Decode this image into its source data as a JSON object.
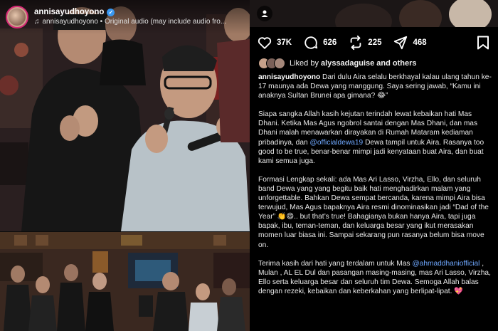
{
  "post": {
    "username": "annisayudhoyono",
    "audio": "annisayudhoyono • Original audio (may include audio fro..."
  },
  "actions": {
    "likes": "37K",
    "comments": "626",
    "reposts": "225",
    "shares": "468"
  },
  "liked_by": {
    "prefix": "Liked by ",
    "user": "alyssadaguise",
    "suffix": " and others"
  },
  "caption": {
    "p1_user": "annisayudhoyono",
    "p1_text": " Dari dulu Aira selalu berkhayal kalau ulang tahun ke-17 maunya ada Dewa yang manggung. Saya sering jawab, “Kamu ini anaknya Sultan Brunei apa gimana? ",
    "p1_emoji": "😂",
    "p1_end": "”",
    "p2_a": "Siapa sangka Allah kasih kejutan terindah lewat kebaikan hati Mas Dhani. Ketika Mas Agus ngobrol santai dengan Mas Dhani, dan mas Dhani malah menawarkan dirayakan di Rumah Mataram kediaman pribadinya, dan ",
    "p2_mention": "@officialdewa19",
    "p2_b": " Dewa tampil untuk Aira. Rasanya too good to be true, benar-benar mimpi jadi kenyataan buat Aira, dan buat kami semua juga.",
    "p3_a": "Formasi Lengkap sekali: ada Mas Ari Lasso, Virzha, Ello, dan seluruh band Dewa yang yang begitu baik hati menghadirkan malam yang unforgettable. Bahkan Dewa sempat bercanda, karena mimpi Aira bisa terwujud, Mas Agus bapaknya Aira resmi dinominasikan jadi “Dad of the Year” ",
    "p3_emoji": "👏😄",
    "p3_b": ".. but that’s true! Bahagianya bukan hanya Aira, tapi juga bapak, ibu, teman-teman, dan keluarga besar yang ikut merasakan momen luar biasa ini. Sampai sekarang pun rasanya belum bisa move on.",
    "p4_a": "Terima kasih dari hati yang terdalam untuk Mas ",
    "p4_mention": "@ahmaddhaniofficial",
    "p4_b": " , Mulan , AL EL Dul dan pasangan masing-masing, mas Ari Lasso, Virzha, Ello serta keluarga besar dan seluruh tim Dewa. Semoga Allah balas dengan rezeki, kebaikan dan keberkahan yang berlipat-lipat. ",
    "p4_emoji": "💖"
  },
  "colors": {
    "background": "#000000",
    "mention": "#6fa8ff",
    "verified": "#3897f0",
    "text": "#e8e8e8"
  }
}
